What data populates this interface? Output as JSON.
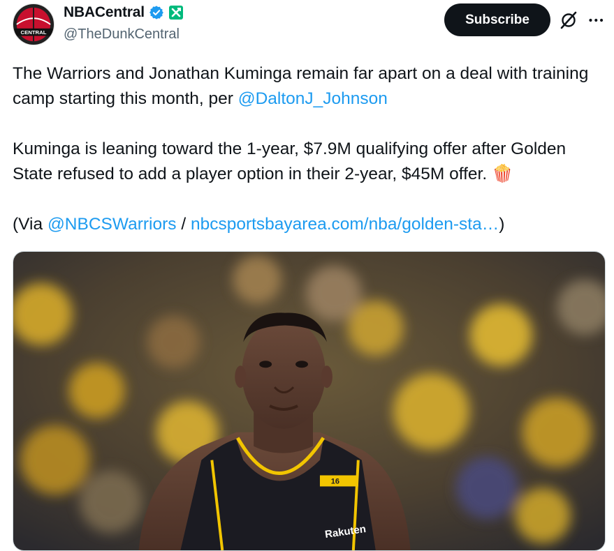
{
  "account": {
    "display_name": "NBACentral",
    "handle": "@TheDunkCentral",
    "avatar_text": "CENTRAL"
  },
  "actions": {
    "subscribe_label": "Subscribe"
  },
  "tweet": {
    "p1_text": "The Warriors and Jonathan Kuminga remain far apart on a deal with training camp starting this month, per ",
    "p1_mention": "@DaltonJ_Johnson",
    "p2_text": "Kuminga is leaning toward the 1-year, $7.9M qualifying offer after Golden State refused to add a player option in their 2-year, $45M offer. ",
    "p2_emoji": "🍿",
    "p3_open": "(Via ",
    "p3_mention": "@NBCSWarriors",
    "p3_sep": " / ",
    "p3_link": "nbcsportsbayarea.com/nba/golden-sta…",
    "p3_close": ")"
  },
  "media": {
    "jersey_number": "16",
    "jersey_sponsor": "Rakuten"
  },
  "colors": {
    "link": "#1d9bf0",
    "verified": "#1d9bf0",
    "affiliate_badge": "#00ba7c",
    "subscribe_bg": "#0f1419"
  },
  "icons": {
    "verified": "verified-badge-icon",
    "affiliate": "affiliate-badge-icon",
    "grok": "grok-icon",
    "more": "more-options-icon"
  }
}
